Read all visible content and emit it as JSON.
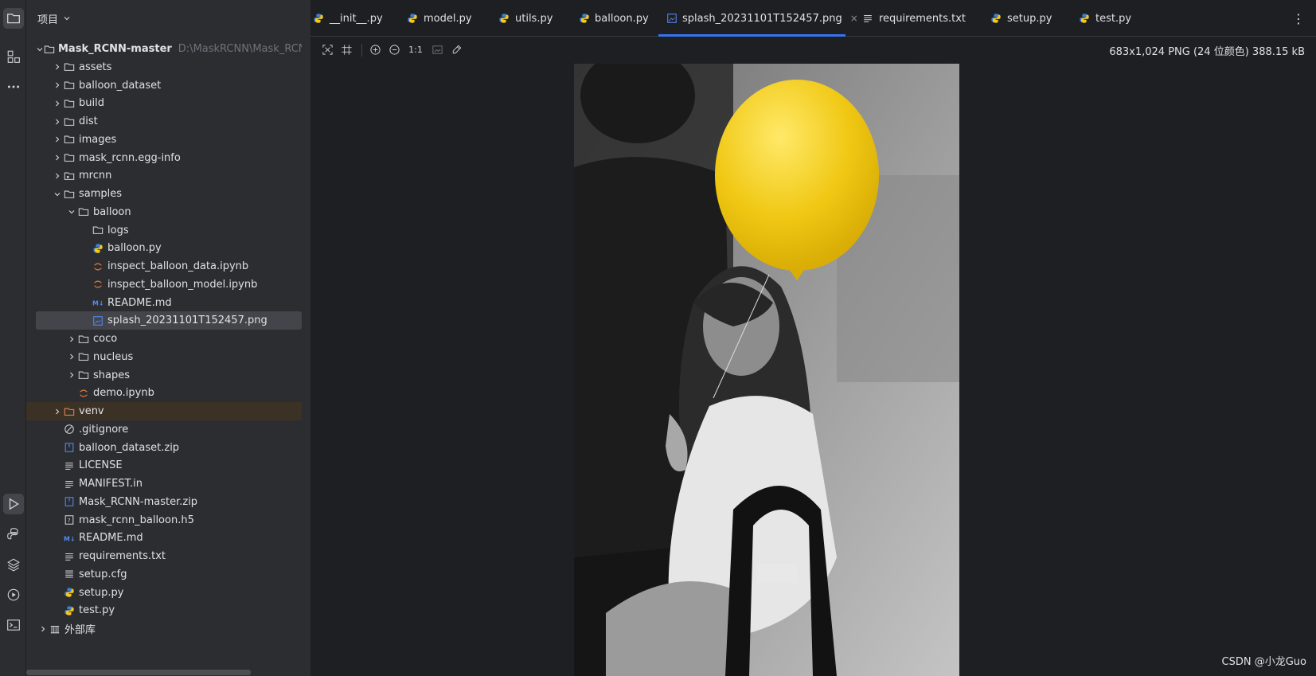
{
  "activity_bar": {
    "items": [
      {
        "name": "project-icon",
        "active": true
      },
      {
        "name": "structure-icon",
        "active": false
      },
      {
        "name": "more-icon",
        "active": false
      },
      {
        "name": "run-icon",
        "active": true
      },
      {
        "name": "python-console-icon",
        "active": false
      },
      {
        "name": "layers-icon",
        "active": false
      },
      {
        "name": "services-icon",
        "active": false
      },
      {
        "name": "terminal-icon",
        "active": false
      }
    ]
  },
  "project": {
    "title": "项目",
    "root_name": "Mask_RCNN-master",
    "root_path": "D:\\MaskRCNN\\Mask_RCNN-",
    "items": [
      {
        "label": "assets",
        "icon": "folder-icon",
        "depth": 1,
        "arrow": "right"
      },
      {
        "label": "balloon_dataset",
        "icon": "folder-icon",
        "depth": 1,
        "arrow": "right"
      },
      {
        "label": "build",
        "icon": "folder-icon",
        "depth": 1,
        "arrow": "right"
      },
      {
        "label": "dist",
        "icon": "folder-icon",
        "depth": 1,
        "arrow": "right"
      },
      {
        "label": "images",
        "icon": "folder-icon",
        "depth": 1,
        "arrow": "right"
      },
      {
        "label": "mask_rcnn.egg-info",
        "icon": "folder-icon",
        "depth": 1,
        "arrow": "right"
      },
      {
        "label": "mrcnn",
        "icon": "package-icon",
        "depth": 1,
        "arrow": "right"
      },
      {
        "label": "samples",
        "icon": "folder-icon",
        "depth": 1,
        "arrow": "down"
      },
      {
        "label": "balloon",
        "icon": "folder-icon",
        "depth": 2,
        "arrow": "down"
      },
      {
        "label": "logs",
        "icon": "folder-icon",
        "depth": 3,
        "arrow": ""
      },
      {
        "label": "balloon.py",
        "icon": "python-icon",
        "depth": 3,
        "arrow": ""
      },
      {
        "label": "inspect_balloon_data.ipynb",
        "icon": "notebook-icon",
        "depth": 3,
        "arrow": ""
      },
      {
        "label": "inspect_balloon_model.ipynb",
        "icon": "notebook-icon",
        "depth": 3,
        "arrow": ""
      },
      {
        "label": "README.md",
        "icon": "markdown-icon",
        "depth": 3,
        "arrow": ""
      },
      {
        "label": "splash_20231101T152457.png",
        "icon": "image-icon",
        "depth": 3,
        "arrow": "",
        "selected": true
      },
      {
        "label": "coco",
        "icon": "folder-icon",
        "depth": 2,
        "arrow": "right"
      },
      {
        "label": "nucleus",
        "icon": "folder-icon",
        "depth": 2,
        "arrow": "right"
      },
      {
        "label": "shapes",
        "icon": "folder-icon",
        "depth": 2,
        "arrow": "right"
      },
      {
        "label": "demo.ipynb",
        "icon": "notebook-icon",
        "depth": 2,
        "arrow": ""
      },
      {
        "label": "venv",
        "icon": "folder-orange-icon",
        "depth": 1,
        "arrow": "right",
        "highlight": true
      },
      {
        "label": ".gitignore",
        "icon": "ignore-icon",
        "depth": 1,
        "arrow": ""
      },
      {
        "label": "balloon_dataset.zip",
        "icon": "archive-icon",
        "depth": 1,
        "arrow": ""
      },
      {
        "label": "LICENSE",
        "icon": "text-icon",
        "depth": 1,
        "arrow": ""
      },
      {
        "label": "MANIFEST.in",
        "icon": "text-icon",
        "depth": 1,
        "arrow": ""
      },
      {
        "label": "Mask_RCNN-master.zip",
        "icon": "archive-icon",
        "depth": 1,
        "arrow": ""
      },
      {
        "label": "mask_rcnn_balloon.h5",
        "icon": "unknown-file-icon",
        "depth": 1,
        "arrow": ""
      },
      {
        "label": "README.md",
        "icon": "markdown-icon",
        "depth": 1,
        "arrow": ""
      },
      {
        "label": "requirements.txt",
        "icon": "text-icon",
        "depth": 1,
        "arrow": ""
      },
      {
        "label": "setup.cfg",
        "icon": "config-icon",
        "depth": 1,
        "arrow": ""
      },
      {
        "label": "setup.py",
        "icon": "python-icon",
        "depth": 1,
        "arrow": ""
      },
      {
        "label": "test.py",
        "icon": "python-icon",
        "depth": 1,
        "arrow": ""
      },
      {
        "label": "外部库",
        "icon": "library-icon",
        "depth": 0,
        "arrow": "right"
      }
    ]
  },
  "tabs": [
    {
      "label": "__init__.py",
      "icon": "python-icon"
    },
    {
      "label": "model.py",
      "icon": "python-icon"
    },
    {
      "label": "utils.py",
      "icon": "python-icon"
    },
    {
      "label": "balloon.py",
      "icon": "python-icon"
    },
    {
      "label": "splash_20231101T152457.png",
      "icon": "image-icon",
      "active": true,
      "close": "×"
    },
    {
      "label": "requirements.txt",
      "icon": "text-icon"
    },
    {
      "label": "setup.py",
      "icon": "python-icon"
    },
    {
      "label": "test.py",
      "icon": "python-icon"
    }
  ],
  "toolbar": {
    "zoom_actual_label": "1:1"
  },
  "image_info": "683x1,024 PNG (24 位颜色) 388.15 kB",
  "watermark": "CSDN @小龙Guo",
  "colors": {
    "accent": "#3574f0",
    "balloon": "#f3cd12",
    "folder_highlight": "#3c3125"
  }
}
